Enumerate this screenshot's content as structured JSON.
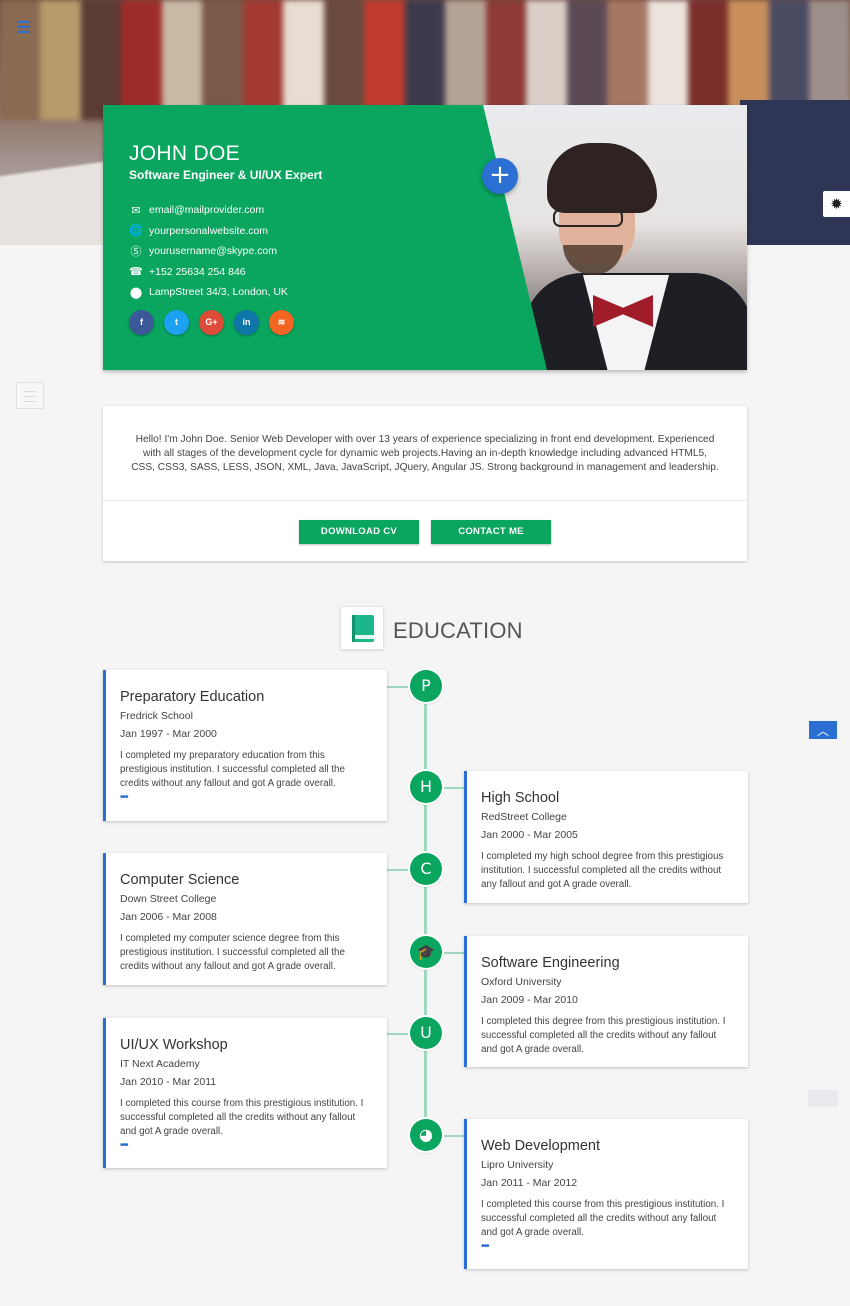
{
  "profile": {
    "name": "JOHN DOE",
    "title": "Software Engineer & UI/UX Expert",
    "contacts": [
      {
        "icon": "email-icon",
        "glyph": "✉",
        "text": "email@mailprovider.com"
      },
      {
        "icon": "globe-icon",
        "glyph": "🌐",
        "text": "yourpersonalwebsite.com"
      },
      {
        "icon": "skype-icon",
        "glyph": "Ⓢ",
        "text": "yourusername@skype.com"
      },
      {
        "icon": "phone-icon",
        "glyph": "☎",
        "text": "+152 25634 254 846"
      },
      {
        "icon": "location-pin-icon",
        "glyph": "⬤",
        "text": "LampStreet 34/3, London, UK"
      }
    ],
    "social": [
      {
        "name": "facebook",
        "label": "f",
        "color": "#3b5998"
      },
      {
        "name": "twitter",
        "label": "t",
        "color": "#1da1f2"
      },
      {
        "name": "google-plus",
        "label": "G+",
        "color": "#dd4b39"
      },
      {
        "name": "linkedin",
        "label": "in",
        "color": "#0e76a8"
      },
      {
        "name": "rss",
        "label": "≋",
        "color": "#f26522"
      }
    ],
    "add_label": "+"
  },
  "about": {
    "text": "Hello! I'm John Doe. Senior Web Developer with over 13 years of experience specializing in front end development. Experienced with all stages of the development cycle for dynamic web projects.Having an in-depth knowledge including advanced HTML5, CSS, CSS3, SASS, LESS, JSON, XML, Java, JavaScript, JQuery, Angular JS. Strong background in management and leadership.",
    "download_label": "DOWNLOAD CV",
    "contact_label": "CONTACT ME"
  },
  "education": {
    "heading": "EDUCATION",
    "more": "•••",
    "items": [
      {
        "node": "P",
        "title": "Preparatory Education",
        "school": "Fredrick School",
        "date": "Jan 1997 - Mar 2000",
        "desc": "I completed my preparatory education from this prestigious institution. I successful completed all the credits without any fallout and got A grade overall."
      },
      {
        "node": "H",
        "title": "High School",
        "school": "RedStreet College",
        "date": "Jan 2000 - Mar 2005",
        "desc": "I completed my high school degree from this prestigious institution. I successful completed all the credits without any fallout and got A grade overall."
      },
      {
        "node": "C",
        "title": "Computer Science",
        "school": "Down Street College",
        "date": "Jan 2006 - Mar 2008",
        "desc": "I completed my computer science degree from this prestigious institution. I successful completed all the credits without any fallout and got A grade overall."
      },
      {
        "node": "🎓",
        "title": "Software Engineering",
        "school": "Oxford University",
        "date": "Jan 2009 - Mar 2010",
        "desc": "I completed this degree from this prestigious institution. I successful completed all the credits without any fallout and got A grade overall."
      },
      {
        "node": "U",
        "title": "UI/UX Workshop",
        "school": "IT Next Academy",
        "date": "Jan 2010 - Mar 2011",
        "desc": "I completed this course from this prestigious institution. I successful completed all the credits without any fallout and got A grade overall."
      },
      {
        "node": "◕",
        "title": "Web Development",
        "school": "Lipro University",
        "date": "Jan 2011 - Mar 2012",
        "desc": "I completed this course from this prestigious institution. I successful completed all the credits without any fallout and got A grade overall."
      }
    ]
  },
  "ui": {
    "settings_glyph": "✹",
    "scroll_top_glyph": "︿"
  }
}
